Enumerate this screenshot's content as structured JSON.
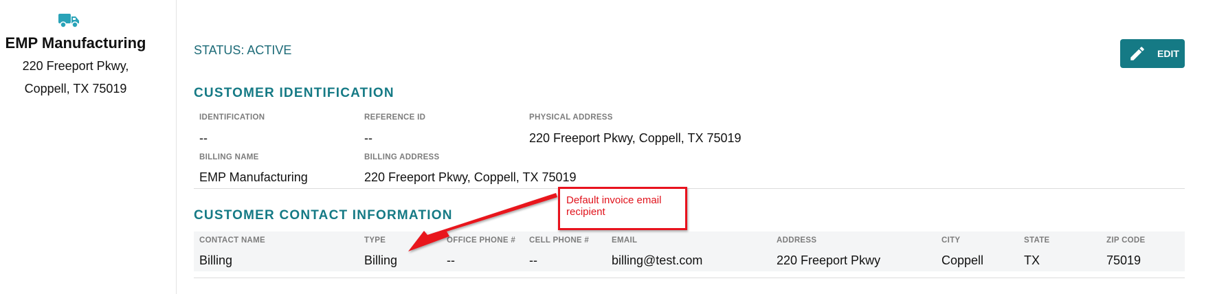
{
  "sidebar": {
    "icon": "truck-icon",
    "customer_name": "EMP Manufacturing",
    "address_line1": "220 Freeport Pkwy,",
    "address_line2": "Coppell, TX 75019"
  },
  "header": {
    "status": "STATUS: ACTIVE",
    "edit_label": "EDIT",
    "edit_icon": "pencil-icon"
  },
  "identification": {
    "title": "CUSTOMER IDENTIFICATION",
    "fields": [
      {
        "label": "IDENTIFICATION",
        "value": "--"
      },
      {
        "label": "REFERENCE ID",
        "value": "--"
      },
      {
        "label": "PHYSICAL ADDRESS",
        "value": "220 Freeport Pkwy, Coppell, TX 75019"
      },
      {
        "label": "BILLING NAME",
        "value": "EMP Manufacturing"
      },
      {
        "label": "BILLING ADDRESS",
        "value": "220 Freeport Pkwy, Coppell, TX 75019"
      }
    ]
  },
  "contacts": {
    "title": "CUSTOMER CONTACT INFORMATION",
    "columns": [
      "CONTACT NAME",
      "TYPE",
      "OFFICE PHONE #",
      "CELL PHONE #",
      "EMAIL",
      "ADDRESS",
      "CITY",
      "STATE",
      "ZIP CODE"
    ],
    "rows": [
      [
        "Billing",
        "Billing",
        "--",
        "--",
        "billing@test.com",
        "220 Freeport Pkwy",
        "Coppell",
        "TX",
        "75019"
      ]
    ]
  },
  "annotation": {
    "text_line1": "Default invoice email",
    "text_line2": "recipient",
    "color": "#e8121d"
  },
  "colors": {
    "accent": "#157a85",
    "status_text": "#1c6a77"
  }
}
